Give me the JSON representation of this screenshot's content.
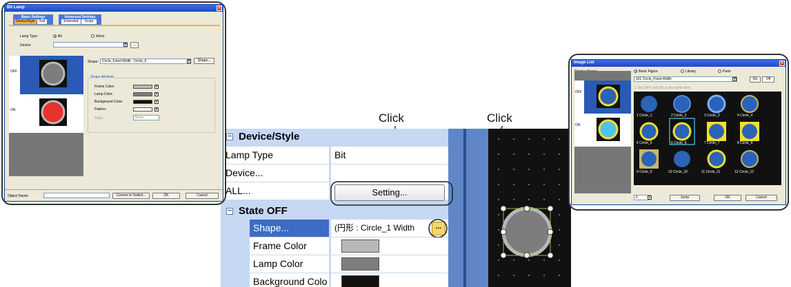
{
  "annotations": {
    "click_left": "Click",
    "click_right": "Click"
  },
  "bit_lamp_dialog": {
    "title": "Bit Lamp",
    "tab_basic": "Basic Settings",
    "tab_advanced": "Advanced Settings",
    "subtab_device_style": "Device/Style",
    "subtab_text": "Text",
    "subtab_extended": "Extended",
    "subtab_script": "Script",
    "lamp_type_label": "Lamp Type:",
    "lamp_type_bit": "Bit",
    "lamp_type_word": "Word",
    "device_label": "Device:",
    "device_btn": "...",
    "state_off": "OFF",
    "state_on": "ON",
    "shape_label": "Shape:",
    "shape_value": "Circle_Fixed Width : Circle_6",
    "shape_button": "Shape...",
    "shape_attribute": "Shape Attribute",
    "frame_color": "Frame Color:",
    "lamp_color": "Lamp Color:",
    "background_color": "Background Color:",
    "pattern": "Pattern:",
    "plate_label": "Plate:",
    "plate_value": "None",
    "object_name_label": "Object Name:",
    "convert_button": "Convert to Switch...",
    "ok": "OK",
    "cancel": "Cancel"
  },
  "property_grid": {
    "section_device_style": "Device/Style",
    "rows": [
      {
        "name": "Lamp Type",
        "value": "Bit"
      },
      {
        "name": "Device...",
        "value": ""
      },
      {
        "name": "ALL...",
        "value": ""
      }
    ],
    "setting_button": "Setting...",
    "section_state_off": "State OFF",
    "shape_name": "Shape...",
    "shape_value": "(円形 : Circle_1  Width",
    "ellipsis": "...",
    "frame_color_name": "Frame Color",
    "lamp_color_name": "Lamp Color",
    "background_color_name": "Background Colo"
  },
  "image_list_dialog": {
    "title": "Image List",
    "display_shape_label": "Display Shape:",
    "radio_basic": "Basic Figure",
    "radio_library": "Library",
    "radio_parts": "Parts",
    "selected_shape": "161 Circle_Fixed Width",
    "on_button": "On",
    "off_button": "Off",
    "checkbox_label": "Set OFF and ON at the same time",
    "state_off": "OFF",
    "state_on": "ON",
    "circles": [
      "1 Circle_1",
      "2 Circle_2",
      "3 Circle_3",
      "4 Circle_4",
      "5 Circle_5",
      "6 Circle_6",
      "7 Circle_7",
      "8 Circle_8",
      "9 Circle_9",
      "10 Circle_10",
      "11 Circle_11",
      "12 Circle_12"
    ],
    "page_number": "6",
    "jump_button": "Jump",
    "ok": "OK",
    "cancel": "Cancel"
  },
  "colors": {
    "frame_gray": "#b8b8b8",
    "lamp_gray": "#7d7d7d",
    "background_black": "#111111",
    "lamp_on_red": "#e8322e",
    "circle_blue": "#2a63b8",
    "highlight_yellow": "#f2e02a",
    "selection_blue": "#3a6fd8"
  }
}
